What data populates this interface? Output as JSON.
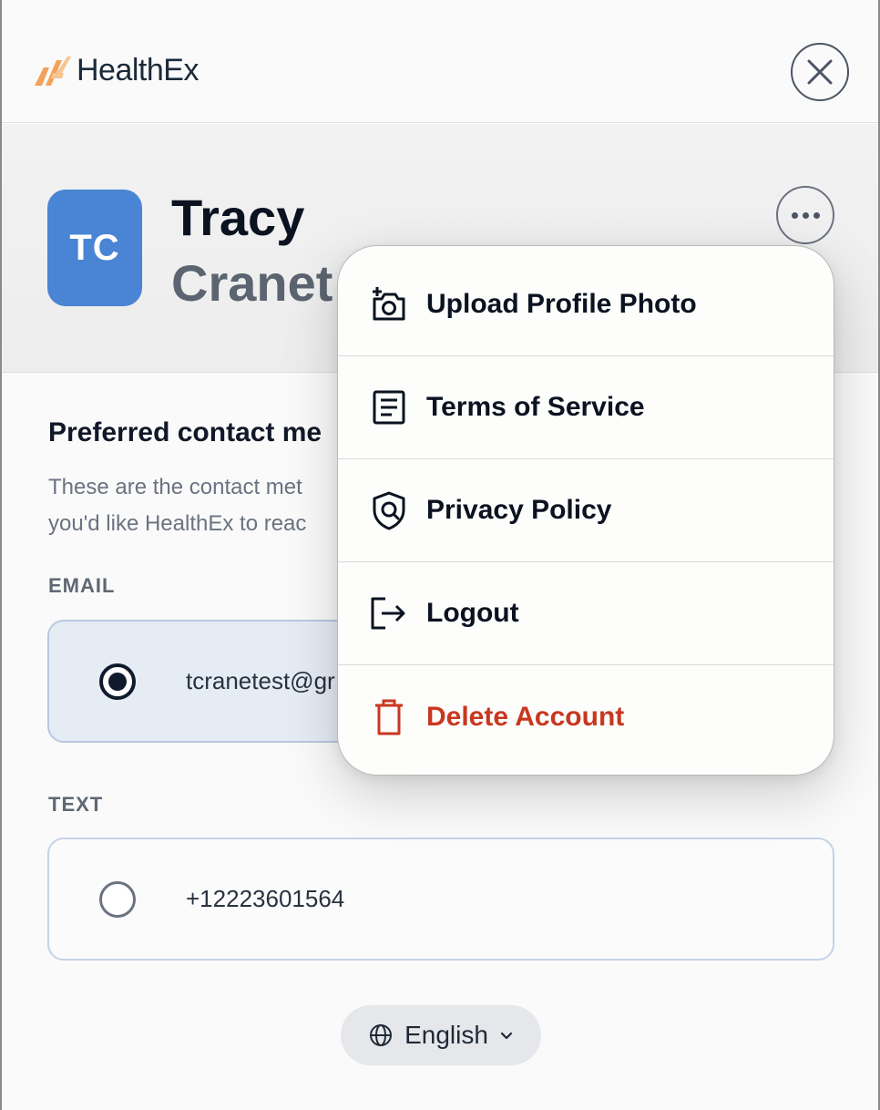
{
  "header": {
    "logo_text": "HealthEx",
    "close_icon": "close-icon",
    "logo_colors": [
      "#f4a259",
      "#f7c58f"
    ]
  },
  "profile": {
    "initials": "TC",
    "first_name": "Tracy",
    "last_name": "Cranet",
    "avatar_color": "#4a84d4",
    "more_icon": "ellipsis-icon"
  },
  "contact": {
    "title": "Preferred contact me",
    "description_line1": "These are the contact met",
    "description_line2": "you'd like HealthEx to reac",
    "email_label": "EMAIL",
    "email_value": "tcranetest@gr",
    "email_selected": true,
    "text_label": "TEXT",
    "text_value": "+12223601564",
    "text_selected": false
  },
  "language": {
    "label": "English",
    "icon": "globe-icon"
  },
  "menu": {
    "items": [
      {
        "label": "Upload Profile Photo",
        "icon": "camera-add-icon"
      },
      {
        "label": "Terms of Service",
        "icon": "document-icon"
      },
      {
        "label": "Privacy Policy",
        "icon": "shield-icon"
      },
      {
        "label": "Logout",
        "icon": "logout-icon"
      },
      {
        "label": "Delete Account",
        "icon": "trash-icon",
        "danger_color": "#c8381f"
      }
    ]
  }
}
